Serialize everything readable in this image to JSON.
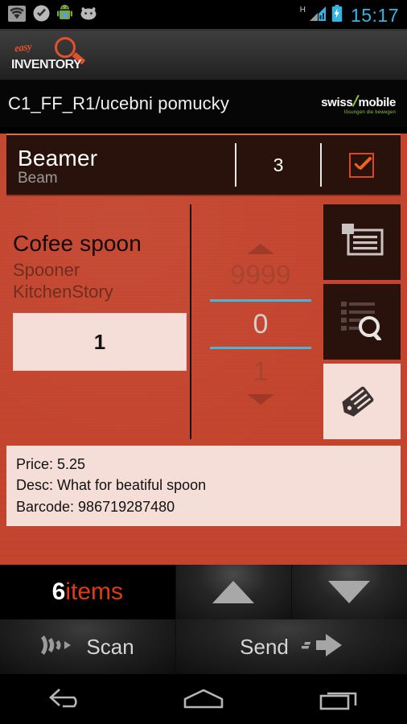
{
  "status_bar": {
    "time": "15:17",
    "network_type": "H",
    "icons": [
      "wifi-icon",
      "check-circle-icon",
      "android-robot-icon",
      "jellybean-face-icon",
      "signal-bars-icon",
      "battery-charging-icon"
    ],
    "accent_color": "#33B5E5"
  },
  "app_bar": {
    "logo_top": "easy",
    "logo_bottom": "INVENTORY",
    "logo_color": "#E2512A"
  },
  "breadcrumb": {
    "path": "C1_FF_R1/ucebni pomucky",
    "brand_word1": "swiss",
    "brand_slash": "/",
    "brand_word2": "mobile",
    "brand_tagline": "lösungen die bewegen",
    "brand_green": "#8DC63F"
  },
  "selected_product": {
    "title": "Beamer",
    "subtitle": "Beam",
    "quantity": "3",
    "checked": true,
    "check_color": "#F4611F"
  },
  "product": {
    "name": "Cofee spoon",
    "line1": "Spooner",
    "line2": "KitchenStory",
    "quantity_value": "1"
  },
  "number_picker": {
    "above_value": "9999",
    "current_value": "0",
    "below_value": "1",
    "divider_color": "#4FB3D4"
  },
  "action_buttons": [
    {
      "name": "note-card-icon",
      "label": "Note"
    },
    {
      "name": "list-search-icon",
      "label": "Find"
    },
    {
      "name": "tag-edit-icon",
      "label": "Tag"
    }
  ],
  "details": {
    "price": "Price: 5.25",
    "description": "Desc: What for beatiful spoon",
    "barcode": "Barcode: 986719287480"
  },
  "toolbar": {
    "items_count": "6",
    "items_label": "items",
    "items_label_color": "#E03C10",
    "up_label": "Previous",
    "down_label": "Next",
    "scan_label": "Scan",
    "send_label": "Send"
  },
  "nav_bar": {
    "back": "back-icon",
    "home": "home-icon",
    "recents": "recents-icon"
  },
  "theme": {
    "orange_bg": "#C4452E",
    "dark_panel": "#2A120C",
    "cream": "#F5DDD8"
  }
}
